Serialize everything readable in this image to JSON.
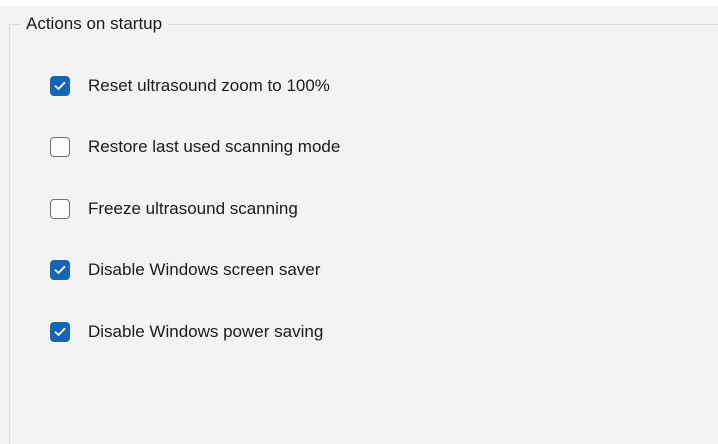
{
  "group": {
    "title": "Actions on startup",
    "options": [
      {
        "label": "Reset ultrasound zoom to 100%",
        "checked": true
      },
      {
        "label": "Restore last used scanning mode",
        "checked": false
      },
      {
        "label": "Freeze ultrasound scanning",
        "checked": false
      },
      {
        "label": "Disable Windows screen saver",
        "checked": true
      },
      {
        "label": "Disable Windows power saving",
        "checked": true
      }
    ]
  },
  "colors": {
    "accent": "#1565b8",
    "background": "#f3f3f3"
  },
  "icons": {
    "check": "checkmark-icon"
  }
}
